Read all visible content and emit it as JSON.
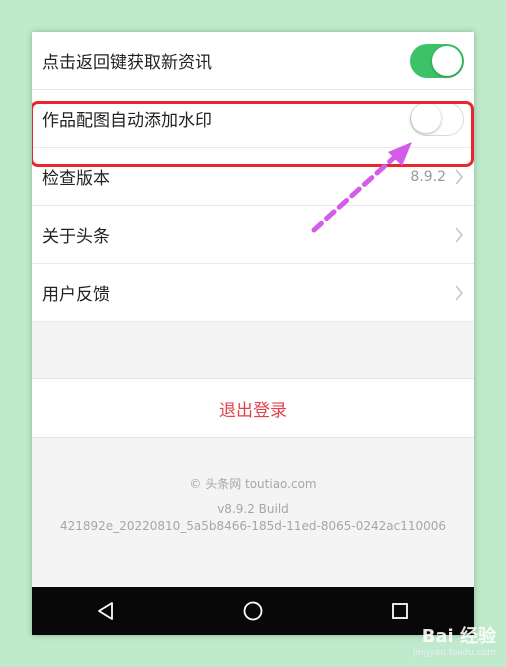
{
  "settings": {
    "items": [
      {
        "label": "点击返回键获取新资讯",
        "toggle": "on"
      },
      {
        "label": "作品配图自动添加水印",
        "toggle": "off"
      },
      {
        "label": "检查版本",
        "value": "8.9.2"
      },
      {
        "label": "关于头条"
      },
      {
        "label": "用户反馈"
      }
    ]
  },
  "logout": {
    "label": "退出登录"
  },
  "footer": {
    "copyright": "© 头条网 toutiao.com",
    "version": "v8.9.2 Build",
    "build": "421892e_20220810_5a5b8466-185d-11ed-8065-0242ac110006"
  },
  "watermark": {
    "brand": "Bai 经验",
    "url": "jingyan.baidu.com"
  },
  "colors": {
    "toggle_on": "#3cc36a",
    "highlight": "#e8262b",
    "arrow": "#d35ce8",
    "logout": "#e0424a",
    "background": "#bfeacb"
  },
  "icons": [
    "chevron-right-icon",
    "back-icon",
    "home-icon",
    "recents-icon"
  ]
}
